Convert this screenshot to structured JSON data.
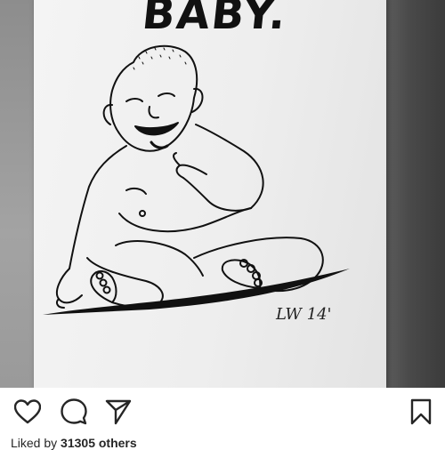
{
  "post": {
    "headline_text": "BABY.",
    "signature_text": "LW 14'"
  },
  "actions": {
    "like_icon": "heart-icon",
    "comment_icon": "comment-icon",
    "share_icon": "send-icon",
    "save_icon": "bookmark-icon"
  },
  "likes": {
    "prefix": "Liked by ",
    "count": "31305",
    "suffix": " others"
  },
  "colors": {
    "ink": "#111111",
    "paper": "#eeeeee",
    "wall_dark": "#3b3b3b"
  }
}
